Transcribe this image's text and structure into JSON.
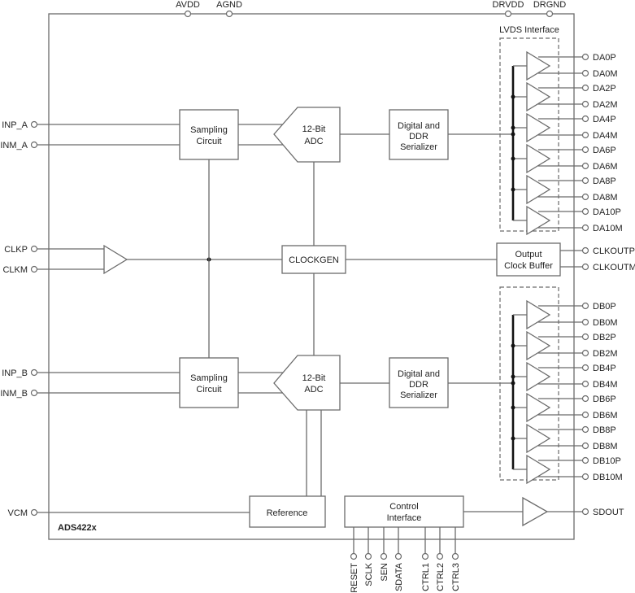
{
  "chip_name": "ADS422x",
  "power_pins": [
    {
      "label": "AVDD"
    },
    {
      "label": "AGND"
    },
    {
      "label": "DRVDD"
    },
    {
      "label": "DRGND"
    }
  ],
  "input_pins": {
    "channel_a": [
      "INP_A",
      "INM_A"
    ],
    "clock": [
      "CLKP",
      "CLKM"
    ],
    "channel_b": [
      "INP_B",
      "INM_B"
    ],
    "vcm": "VCM"
  },
  "blocks": {
    "sampling_a": [
      "Sampling",
      "Circuit"
    ],
    "adc_a": [
      "12-Bit",
      "ADC"
    ],
    "serializer_a": [
      "Digital and",
      "DDR",
      "Serializer"
    ],
    "clockgen": "CLOCKGEN",
    "output_clock_buffer": [
      "Output",
      "Clock Buffer"
    ],
    "sampling_b": [
      "Sampling",
      "Circuit"
    ],
    "adc_b": [
      "12-Bit",
      "ADC"
    ],
    "serializer_b": [
      "Digital and",
      "DDR",
      "Serializer"
    ],
    "reference": "Reference",
    "control_interface": [
      "Control",
      "Interface"
    ]
  },
  "lvds_interface_label": "LVDS Interface",
  "output_pins_a": [
    "DA0P",
    "DA0M",
    "DA2P",
    "DA2M",
    "DA4P",
    "DA4M",
    "DA6P",
    "DA6M",
    "DA8P",
    "DA8M",
    "DA10P",
    "DA10M"
  ],
  "clock_out_pins": [
    "CLKOUTP",
    "CLKOUTM"
  ],
  "output_pins_b": [
    "DB0P",
    "DB0M",
    "DB2P",
    "DB2M",
    "DB4P",
    "DB4M",
    "DB6P",
    "DB6M",
    "DB8P",
    "DB8M",
    "DB10P",
    "DB10M"
  ],
  "sdout_pin": "SDOUT",
  "control_pins": [
    "RESET",
    "SCLK",
    "SEN",
    "SDATA",
    "CTRL1",
    "CTRL2",
    "CTRL3"
  ]
}
